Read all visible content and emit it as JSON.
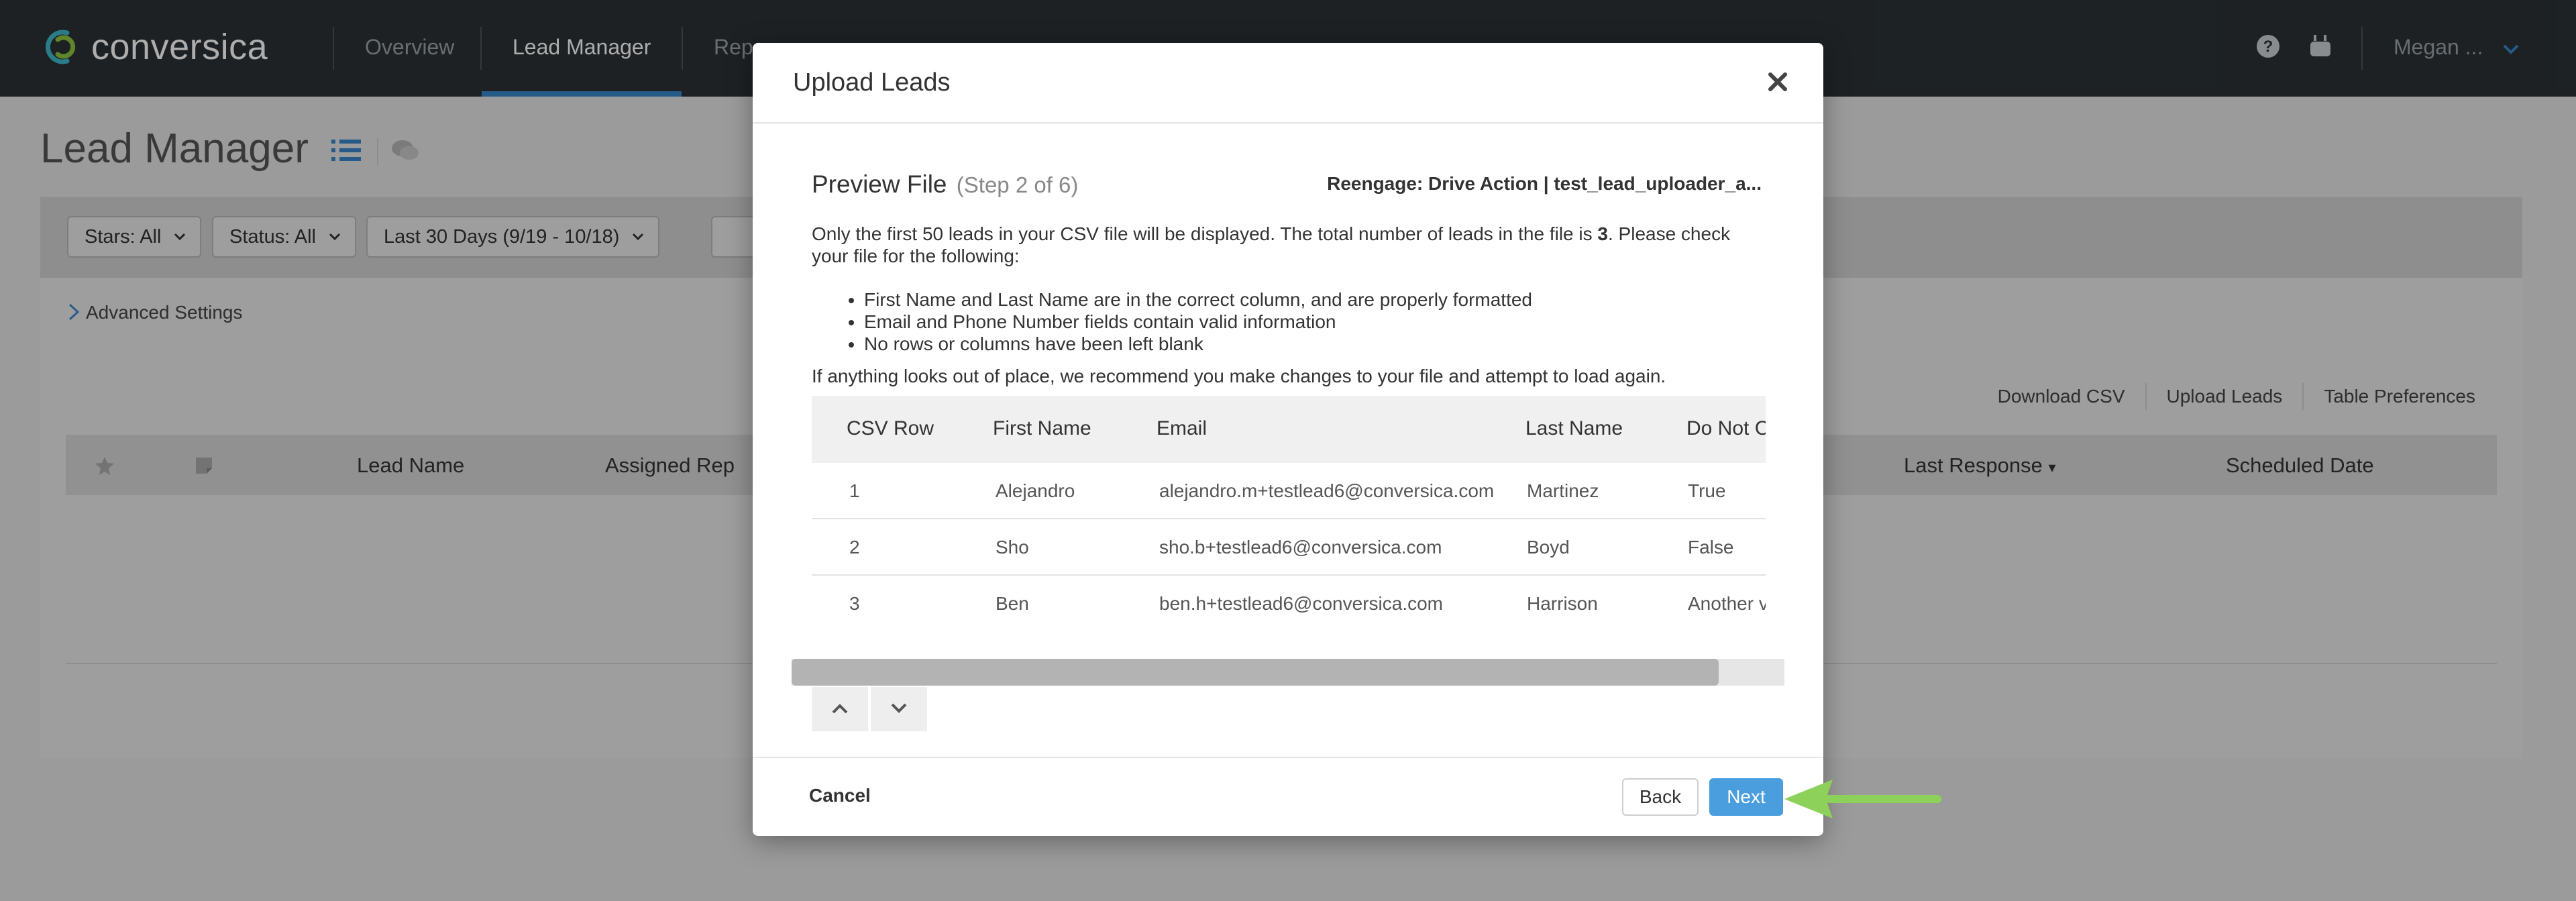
{
  "brand": {
    "name": "conversica"
  },
  "nav": {
    "items": [
      {
        "label": "Overview"
      },
      {
        "label": "Lead Manager"
      },
      {
        "label": "Repo"
      }
    ],
    "user": "Megan ..."
  },
  "page": {
    "title": "Lead Manager",
    "filters": {
      "stars": "Stars: All",
      "status": "Status: All",
      "date_range": "Last 30 Days (9/19 - 10/18)"
    },
    "advanced_settings": "Advanced Settings",
    "table_actions": [
      "Download CSV",
      "Upload Leads",
      "Table Preferences"
    ],
    "columns": {
      "lead_name": "Lead Name",
      "assigned_rep": "Assigned Rep",
      "last_response": "Last Response",
      "scheduled_date": "Scheduled Date"
    }
  },
  "modal": {
    "title": "Upload Leads",
    "preview_title": "Preview File",
    "step": "(Step 2 of 6)",
    "campaign": "Reengage: Drive Action | test_lead_uploader_a...",
    "intro_before": "Only the first 50 leads in your CSV file will be displayed. The total number of leads in the file is ",
    "lead_count": "3",
    "intro_after": ". Please check your file for the following:",
    "checklist": [
      "First Name and Last Name are in the correct column, and are properly formatted",
      "Email and Phone Number fields contain valid information",
      "No rows or columns have been left blank"
    ],
    "advice": "If anything looks out of place, we recommend you make changes to your file and attempt to load again.",
    "preview_table": {
      "headers": [
        "CSV Row",
        "First Name",
        "Email",
        "Last Name",
        "Do Not Co"
      ],
      "rows": [
        [
          "1",
          "Alejandro",
          "alejandro.m+testlead6@conversica.com",
          "Martinez",
          "True"
        ],
        [
          "2",
          "Sho",
          "sho.b+testlead6@conversica.com",
          "Boyd",
          "False"
        ],
        [
          "3",
          "Ben",
          "ben.h+testlead6@conversica.com",
          "Harrison",
          "Another val"
        ]
      ]
    },
    "footer": {
      "cancel": "Cancel",
      "back": "Back",
      "next": "Next"
    }
  },
  "colors": {
    "nav_bg": "#2b3236",
    "accent": "#3a87c8",
    "next_button": "#4a9ede",
    "annotation_arrow": "#8ed15a"
  }
}
